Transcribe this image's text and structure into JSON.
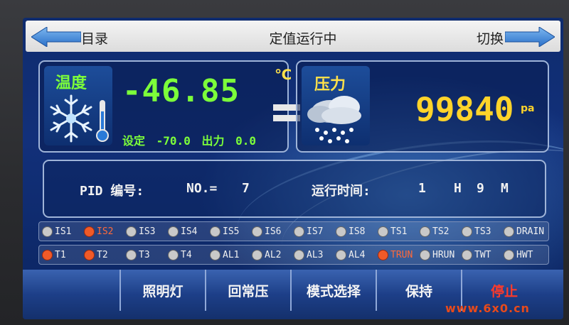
{
  "header": {
    "menu_label": "目录",
    "title": "定值运行中",
    "switch_label": "切换"
  },
  "temperature": {
    "label": "温度",
    "value": "-46.85",
    "unit": "℃",
    "set_label": "设定",
    "set_value": "-70.0",
    "output_label": "出力",
    "output_value": "0.0"
  },
  "pressure": {
    "label": "压力",
    "value": "99840",
    "unit": "pa"
  },
  "info": {
    "pid_label": "PID 编号:",
    "no_label": "NO.=",
    "no_value": "7",
    "runtime_label": "运行时间:",
    "hours": "1",
    "h_unit": "H",
    "minutes": "9",
    "m_unit": "M"
  },
  "indicators_row1": [
    {
      "label": "IS1",
      "on": false
    },
    {
      "label": "IS2",
      "on": true
    },
    {
      "label": "IS3",
      "on": false
    },
    {
      "label": "IS4",
      "on": false
    },
    {
      "label": "IS5",
      "on": false
    },
    {
      "label": "IS6",
      "on": false
    },
    {
      "label": "IS7",
      "on": false
    },
    {
      "label": "IS8",
      "on": false
    },
    {
      "label": "TS1",
      "on": false
    },
    {
      "label": "TS2",
      "on": false
    },
    {
      "label": "TS3",
      "on": false
    },
    {
      "label": "DRAIN",
      "on": false
    }
  ],
  "indicators_row2": [
    {
      "label": "T1",
      "on": true
    },
    {
      "label": "T2",
      "on": true
    },
    {
      "label": "T3",
      "on": false
    },
    {
      "label": "T4",
      "on": false
    },
    {
      "label": "AL1",
      "on": false
    },
    {
      "label": "AL2",
      "on": false
    },
    {
      "label": "AL3",
      "on": false
    },
    {
      "label": "AL4",
      "on": false
    },
    {
      "label": "TRUN",
      "on": true
    },
    {
      "label": "HRUN",
      "on": false
    },
    {
      "label": "TWT",
      "on": false
    },
    {
      "label": "HWT",
      "on": false
    }
  ],
  "buttons": {
    "light": "照明灯",
    "normal_pressure": "回常压",
    "mode_select": "模式选择",
    "hold": "保持",
    "stop": "停止"
  },
  "watermark": "www.6x0.cn",
  "colors": {
    "temp_green": "#7cff3a",
    "pressure_yellow": "#ffd42a",
    "indicator_on": "#f05a28",
    "stop_red": "#ff3a2a"
  }
}
